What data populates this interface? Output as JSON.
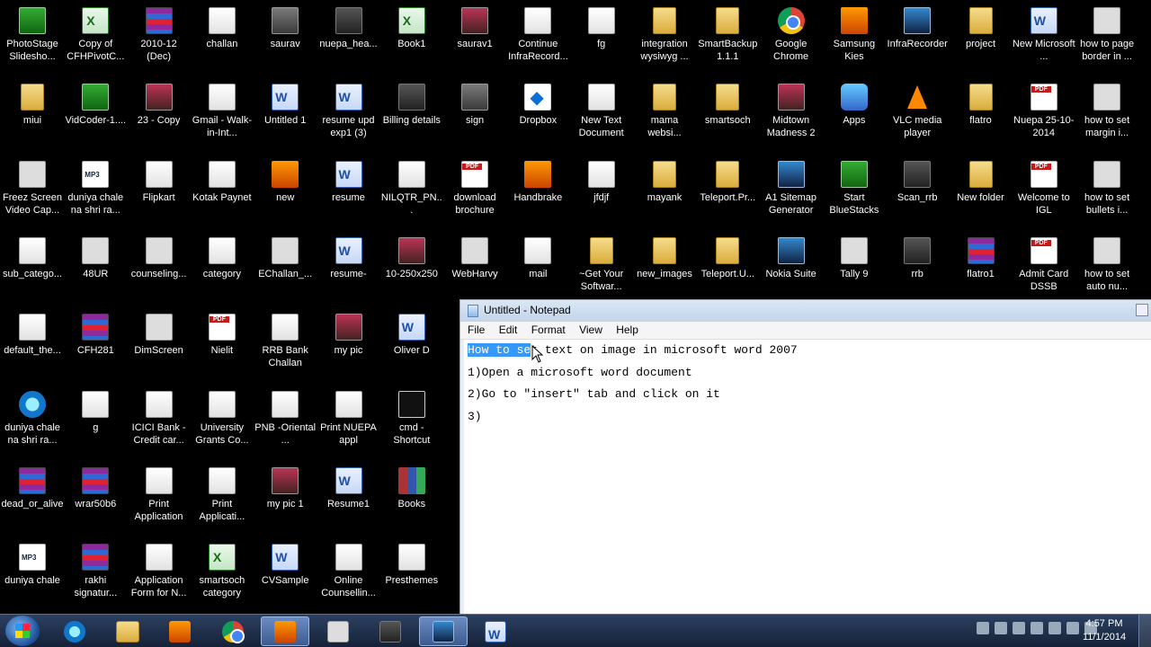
{
  "desktop": {
    "icons": [
      {
        "label": "PhotoStage Slidesho...",
        "icon": "green-icon",
        "col": 0,
        "row": 0
      },
      {
        "label": "Copy of CFHPivotC...",
        "icon": "excel-icon",
        "col": 1,
        "row": 0
      },
      {
        "label": "2010-12 (Dec)",
        "icon": "rar-icon",
        "col": 2,
        "row": 0
      },
      {
        "label": "challan",
        "icon": "document-icon",
        "col": 3,
        "row": 0
      },
      {
        "label": "saurav",
        "icon": "image-icon",
        "col": 4,
        "row": 0
      },
      {
        "label": "nuepa_hea...",
        "icon": "dark-icon",
        "col": 5,
        "row": 0
      },
      {
        "label": "Book1",
        "icon": "excel-icon",
        "col": 6,
        "row": 0
      },
      {
        "label": "saurav1",
        "icon": "photo-icon",
        "col": 7,
        "row": 0
      },
      {
        "label": "Continue InfraRecord...",
        "icon": "document-icon",
        "col": 8,
        "row": 0
      },
      {
        "label": "fg",
        "icon": "document-icon",
        "col": 9,
        "row": 0
      },
      {
        "label": "integration wysiwyg ...",
        "icon": "folder-icon",
        "col": 10,
        "row": 0
      },
      {
        "label": "SmartBackup 1.1.1",
        "icon": "folder-icon",
        "col": 11,
        "row": 0
      },
      {
        "label": "Google Chrome",
        "icon": "chrome-icon",
        "col": 12,
        "row": 0
      },
      {
        "label": "Samsung Kies",
        "icon": "orange-icon",
        "col": 13,
        "row": 0
      },
      {
        "label": "InfraRecorder",
        "icon": "blue-icon",
        "col": 14,
        "row": 0
      },
      {
        "label": "project",
        "icon": "folder-icon",
        "col": 15,
        "row": 0
      },
      {
        "label": "New Microsoft ...",
        "icon": "word-icon",
        "col": 16,
        "row": 0
      },
      {
        "label": "how to page border in ...",
        "icon": "light-icon",
        "col": 17,
        "row": 0
      },
      {
        "label": "miui",
        "icon": "folder-icon",
        "col": 0,
        "row": 1
      },
      {
        "label": "VidCoder-1....",
        "icon": "green-icon",
        "col": 1,
        "row": 1
      },
      {
        "label": "23 - Copy",
        "icon": "photo-icon",
        "col": 2,
        "row": 1
      },
      {
        "label": "Gmail - Walk-in-Int...",
        "icon": "document-icon",
        "col": 3,
        "row": 1
      },
      {
        "label": "Untitled 1",
        "icon": "word-icon",
        "col": 4,
        "row": 1
      },
      {
        "label": "resume upd exp1 (3)",
        "icon": "word-icon",
        "col": 5,
        "row": 1
      },
      {
        "label": "Billing details",
        "icon": "dark-icon",
        "col": 6,
        "row": 1
      },
      {
        "label": "sign",
        "icon": "image-icon",
        "col": 7,
        "row": 1
      },
      {
        "label": "Dropbox",
        "icon": "dropbox-icon",
        "col": 8,
        "row": 1
      },
      {
        "label": "New Text Document",
        "icon": "document-icon",
        "col": 9,
        "row": 1
      },
      {
        "label": "mama websi...",
        "icon": "folder-icon",
        "col": 10,
        "row": 1
      },
      {
        "label": "smartsoch",
        "icon": "folder-icon",
        "col": 11,
        "row": 1
      },
      {
        "label": "Midtown Madness 2",
        "icon": "photo-icon",
        "col": 12,
        "row": 1
      },
      {
        "label": "Apps",
        "icon": "apps-icon",
        "col": 13,
        "row": 1
      },
      {
        "label": "VLC media player",
        "icon": "vlc-icon",
        "col": 14,
        "row": 1
      },
      {
        "label": "flatro",
        "icon": "folder-icon",
        "col": 15,
        "row": 1
      },
      {
        "label": "Nuepa 25-10-2014",
        "icon": "pdf-icon",
        "col": 16,
        "row": 1
      },
      {
        "label": "how to set margin i...",
        "icon": "light-icon",
        "col": 17,
        "row": 1
      },
      {
        "label": "Freez Screen Video Cap...",
        "icon": "light-icon",
        "col": 0,
        "row": 2
      },
      {
        "label": "duniya chale na shri ra...",
        "icon": "mp3-icon",
        "col": 1,
        "row": 2
      },
      {
        "label": "Flipkart",
        "icon": "document-icon",
        "col": 2,
        "row": 2
      },
      {
        "label": "Kotak Paynet",
        "icon": "document-icon",
        "col": 3,
        "row": 2
      },
      {
        "label": "new",
        "icon": "orange-icon",
        "col": 4,
        "row": 2
      },
      {
        "label": "resume",
        "icon": "word-icon",
        "col": 5,
        "row": 2
      },
      {
        "label": "NILQTR_PN...",
        "icon": "document-icon",
        "col": 6,
        "row": 2
      },
      {
        "label": "download brochure",
        "icon": "pdf-icon",
        "col": 7,
        "row": 2
      },
      {
        "label": "Handbrake",
        "icon": "orange-icon",
        "col": 8,
        "row": 2
      },
      {
        "label": "jfdjf",
        "icon": "document-icon",
        "col": 9,
        "row": 2
      },
      {
        "label": "mayank",
        "icon": "folder-icon",
        "col": 10,
        "row": 2
      },
      {
        "label": "Teleport.Pr...",
        "icon": "folder-icon",
        "col": 11,
        "row": 2
      },
      {
        "label": "A1 Sitemap Generator",
        "icon": "blue-icon",
        "col": 12,
        "row": 2
      },
      {
        "label": "Start BlueStacks",
        "icon": "green-icon",
        "col": 13,
        "row": 2
      },
      {
        "label": "Scan_rrb",
        "icon": "dark-icon",
        "col": 14,
        "row": 2
      },
      {
        "label": "New folder",
        "icon": "folder-icon",
        "col": 15,
        "row": 2
      },
      {
        "label": "Welcome to IGL",
        "icon": "pdf-icon",
        "col": 16,
        "row": 2
      },
      {
        "label": "how to set bullets i...",
        "icon": "light-icon",
        "col": 17,
        "row": 2
      },
      {
        "label": "sub_catego...",
        "icon": "document-icon",
        "col": 0,
        "row": 3
      },
      {
        "label": "48UR",
        "icon": "light-icon",
        "col": 1,
        "row": 3
      },
      {
        "label": "counseling...",
        "icon": "light-icon",
        "col": 2,
        "row": 3
      },
      {
        "label": "category",
        "icon": "document-icon",
        "col": 3,
        "row": 3
      },
      {
        "label": "EChallan_...",
        "icon": "light-icon",
        "col": 4,
        "row": 3
      },
      {
        "label": "resume-",
        "icon": "word-icon",
        "col": 5,
        "row": 3
      },
      {
        "label": "10-250x250",
        "icon": "photo-icon",
        "col": 6,
        "row": 3
      },
      {
        "label": "WebHarvy",
        "icon": "light-icon",
        "col": 7,
        "row": 3
      },
      {
        "label": "mail",
        "icon": "document-icon",
        "col": 8,
        "row": 3
      },
      {
        "label": "~Get Your Softwar...",
        "icon": "folder-icon",
        "col": 9,
        "row": 3
      },
      {
        "label": "new_images",
        "icon": "folder-icon",
        "col": 10,
        "row": 3
      },
      {
        "label": "Teleport.U...",
        "icon": "folder-icon",
        "col": 11,
        "row": 3
      },
      {
        "label": "Nokia Suite",
        "icon": "blue-icon",
        "col": 12,
        "row": 3
      },
      {
        "label": "Tally 9",
        "icon": "light-icon",
        "col": 13,
        "row": 3
      },
      {
        "label": "rrb",
        "icon": "dark-icon",
        "col": 14,
        "row": 3
      },
      {
        "label": "flatro1",
        "icon": "rar-icon",
        "col": 15,
        "row": 3
      },
      {
        "label": "Admit Card DSSB",
        "icon": "pdf-icon",
        "col": 16,
        "row": 3
      },
      {
        "label": "how to set auto nu...",
        "icon": "light-icon",
        "col": 17,
        "row": 3
      },
      {
        "label": "default_the...",
        "icon": "document-icon",
        "col": 0,
        "row": 4
      },
      {
        "label": "CFH281",
        "icon": "rar-icon",
        "col": 1,
        "row": 4
      },
      {
        "label": "DimScreen",
        "icon": "light-icon",
        "col": 2,
        "row": 4
      },
      {
        "label": "Nielit",
        "icon": "pdf-icon",
        "col": 3,
        "row": 4
      },
      {
        "label": "RRB Bank Challan",
        "icon": "document-icon",
        "col": 4,
        "row": 4
      },
      {
        "label": "my pic",
        "icon": "photo-icon",
        "col": 5,
        "row": 4
      },
      {
        "label": "Oliver D",
        "icon": "word-icon",
        "col": 6,
        "row": 4
      },
      {
        "label": "duniya chale na shri ra...",
        "icon": "ie-icon",
        "col": 0,
        "row": 5
      },
      {
        "label": "g",
        "icon": "document-icon",
        "col": 1,
        "row": 5
      },
      {
        "label": "ICICI Bank - Credit car...",
        "icon": "document-icon",
        "col": 2,
        "row": 5
      },
      {
        "label": "University Grants Co...",
        "icon": "document-icon",
        "col": 3,
        "row": 5
      },
      {
        "label": "PNB -Oriental ...",
        "icon": "document-icon",
        "col": 4,
        "row": 5
      },
      {
        "label": "Print NUEPA appl",
        "icon": "document-icon",
        "col": 5,
        "row": 5
      },
      {
        "label": "cmd - Shortcut",
        "icon": "cmd-icon",
        "col": 6,
        "row": 5
      },
      {
        "label": "dead_or_alive",
        "icon": "rar-icon",
        "col": 0,
        "row": 6
      },
      {
        "label": "wrar50b6",
        "icon": "rar-icon",
        "col": 1,
        "row": 6
      },
      {
        "label": "Print Application",
        "icon": "document-icon",
        "col": 2,
        "row": 6
      },
      {
        "label": "Print Applicati...",
        "icon": "document-icon",
        "col": 3,
        "row": 6
      },
      {
        "label": "my pic 1",
        "icon": "photo-icon",
        "col": 4,
        "row": 6
      },
      {
        "label": "Resume1",
        "icon": "word-icon",
        "col": 5,
        "row": 6
      },
      {
        "label": "Books",
        "icon": "books-icon",
        "col": 6,
        "row": 6
      },
      {
        "label": "duniya chale",
        "icon": "mp3-icon",
        "col": 0,
        "row": 7
      },
      {
        "label": "rakhi signatur...",
        "icon": "rar-icon",
        "col": 1,
        "row": 7
      },
      {
        "label": "Application Form for N...",
        "icon": "document-icon",
        "col": 2,
        "row": 7
      },
      {
        "label": "smartsoch category",
        "icon": "excel-icon",
        "col": 3,
        "row": 7
      },
      {
        "label": "CVSample",
        "icon": "word-icon",
        "col": 4,
        "row": 7
      },
      {
        "label": "Online Counsellin...",
        "icon": "document-icon",
        "col": 5,
        "row": 7
      },
      {
        "label": "Presthemes",
        "icon": "document-icon",
        "col": 6,
        "row": 7
      }
    ]
  },
  "notepad": {
    "title": "Untitled - Notepad",
    "menu": [
      "File",
      "Edit",
      "Format",
      "View",
      "Help"
    ],
    "selected_text": "How to se",
    "lines": [
      "t text on image in microsoft word 2007",
      "1)Open a microsoft word document",
      "2)Go to \"insert\" tab and click on it",
      "3)"
    ]
  },
  "taskbar": {
    "items": [
      {
        "name": "ie-taskbar",
        "icon": "ie-icon",
        "active": false
      },
      {
        "name": "explorer-taskbar",
        "icon": "folder-icon",
        "active": false
      },
      {
        "name": "media-player-taskbar",
        "icon": "orange-icon",
        "active": false
      },
      {
        "name": "chrome-taskbar",
        "icon": "chrome-icon",
        "active": false
      },
      {
        "name": "firefox-taskbar",
        "icon": "firefox-icon",
        "active": true
      },
      {
        "name": "blank-window-taskbar",
        "icon": "light-icon",
        "active": false
      },
      {
        "name": "camera-taskbar",
        "icon": "dark-icon",
        "active": false
      },
      {
        "name": "notepad-taskbar",
        "icon": "notepad-icon",
        "active": true
      },
      {
        "name": "word-taskbar",
        "icon": "word-icon",
        "active": false
      }
    ],
    "clock_time": "4:57 PM",
    "clock_date": "11/1/2014"
  }
}
